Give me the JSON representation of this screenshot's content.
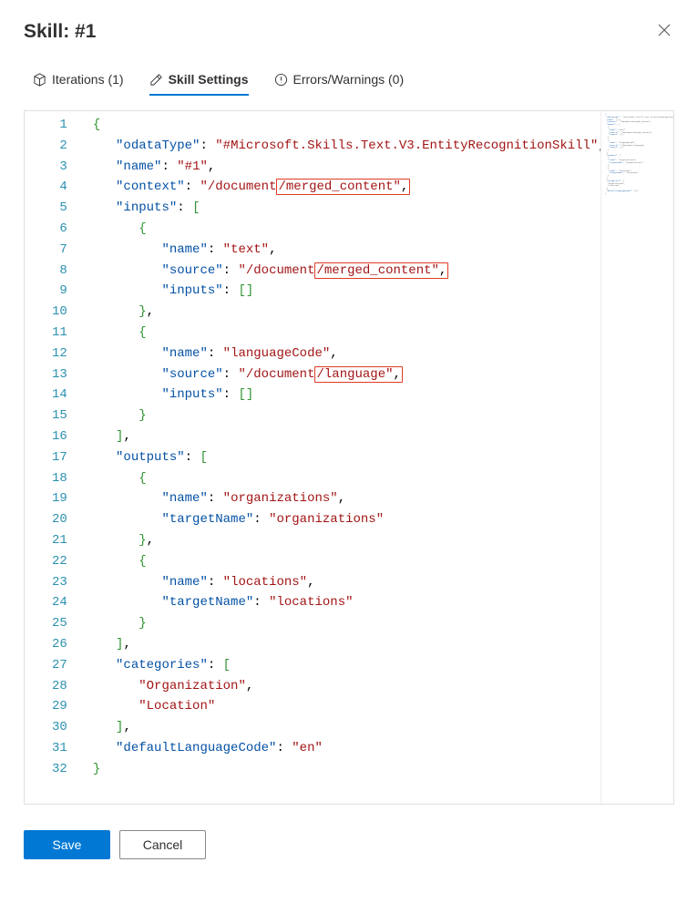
{
  "header": {
    "title": "Skill: #1"
  },
  "tabs": {
    "iterations": {
      "label": "Iterations (1)"
    },
    "settings": {
      "label": "Skill Settings"
    },
    "errors": {
      "label": "Errors/Warnings (0)"
    }
  },
  "buttons": {
    "save": "Save",
    "cancel": "Cancel"
  },
  "skill_json": {
    "odataType": "#Microsoft.Skills.Text.V3.EntityRecognitionSkill",
    "name": "#1",
    "context": "/document/merged_content",
    "inputs": [
      {
        "name": "text",
        "source": "/document/merged_content",
        "inputs": []
      },
      {
        "name": "languageCode",
        "source": "/document/language",
        "inputs": []
      }
    ],
    "outputs": [
      {
        "name": "organizations",
        "targetName": "organizations"
      },
      {
        "name": "locations",
        "targetName": "locations"
      }
    ],
    "categories": [
      "Organization",
      "Location"
    ],
    "defaultLanguageCode": "en"
  },
  "highlights": [
    {
      "line": 4,
      "text": "/merged_content\","
    },
    {
      "line": 8,
      "text": "/merged_content\","
    },
    {
      "line": 13,
      "text": "/language\","
    }
  ],
  "line_count": 32
}
